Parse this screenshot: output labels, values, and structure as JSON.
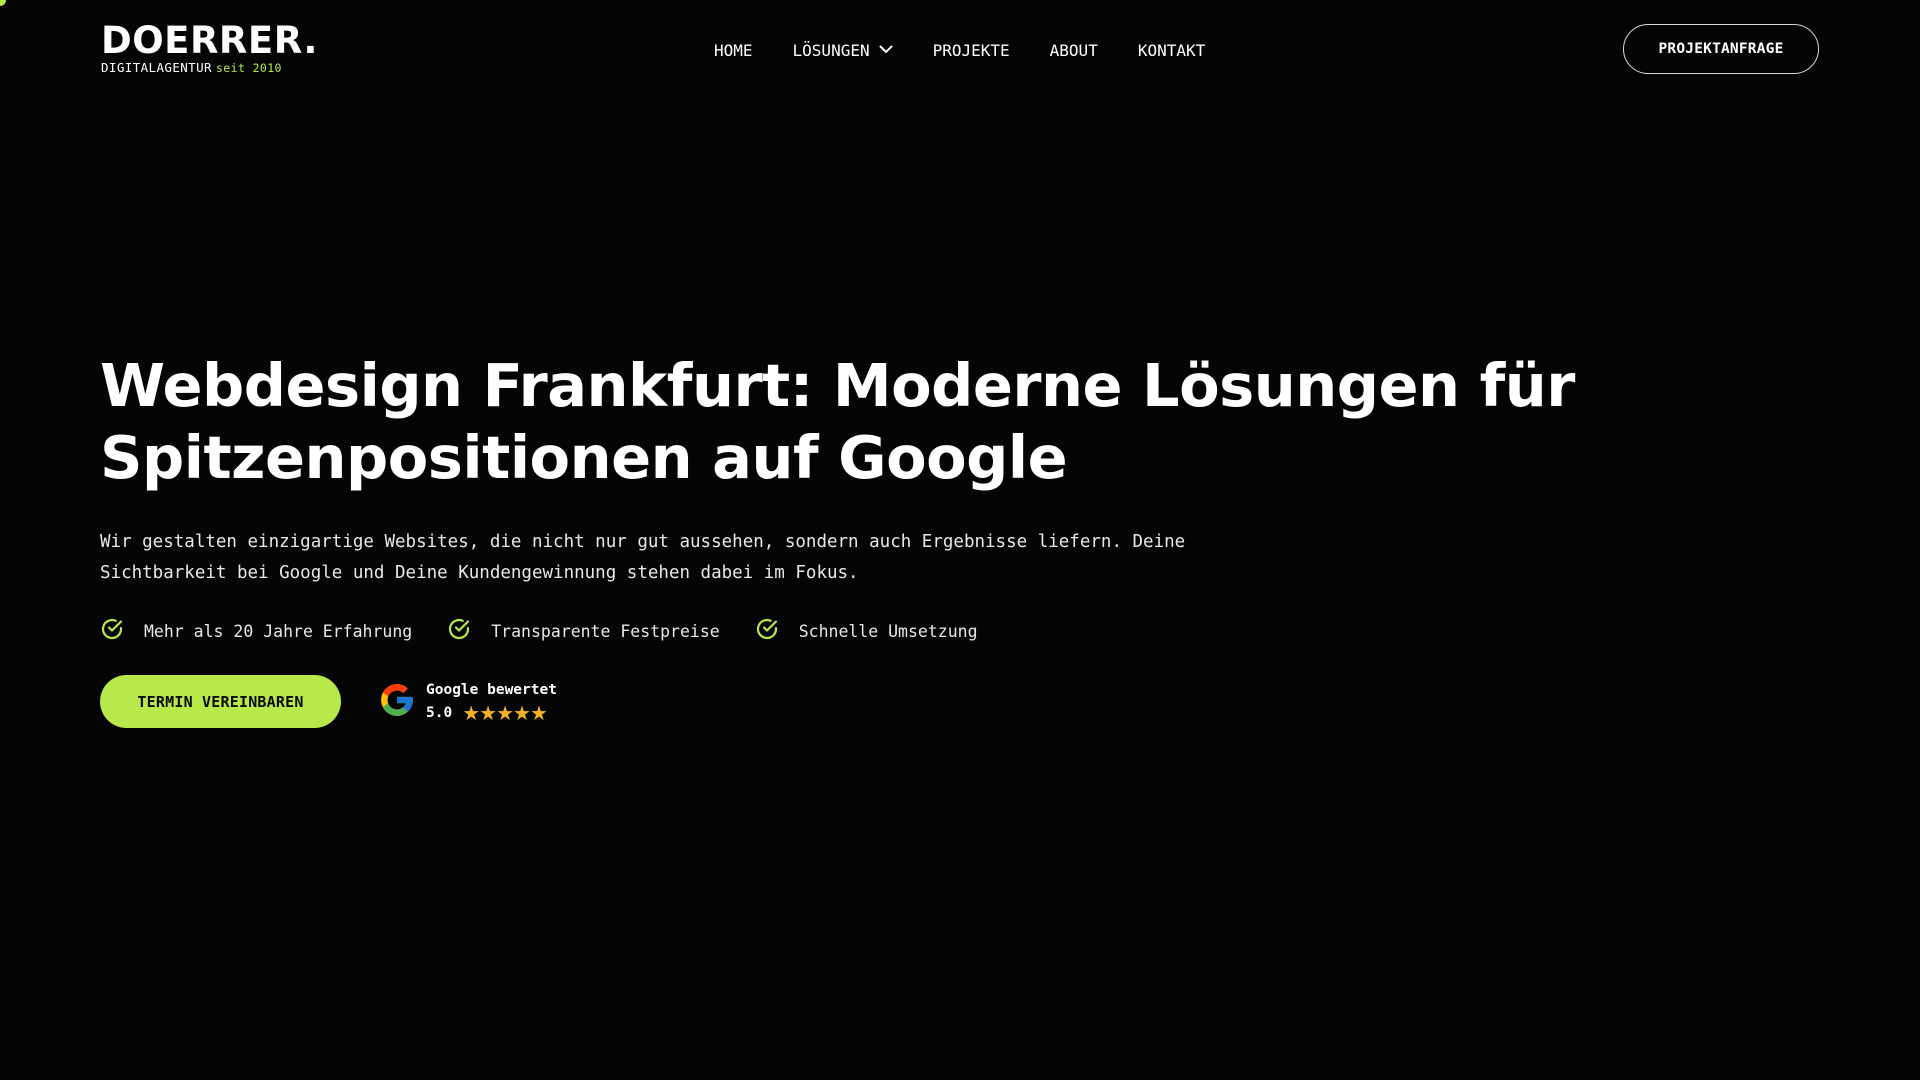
{
  "brand": {
    "name": "DOERRER.",
    "tagline": "DIGITALAGENTUR",
    "since": "seit 2010",
    "accent_color": "#b8e94a"
  },
  "nav": {
    "items": [
      {
        "label": "HOME"
      },
      {
        "label": "LÖSUNGEN",
        "icon": "chevron-down-icon"
      },
      {
        "label": "PROJEKTE"
      },
      {
        "label": "ABOUT"
      },
      {
        "label": "KONTAKT"
      }
    ],
    "cta_label": "PROJEKTANFRAGE"
  },
  "hero": {
    "title_line1": "Webdesign Frankfurt: Moderne Lösungen für",
    "title_line2": "Spitzenpositionen auf Google",
    "text_line1": "Wir gestalten einzigartige Websites, die nicht nur gut aussehen, sondern auch Ergebnisse liefern. Deine",
    "text_line2": "Sichtbarkeit bei Google und Deine Kundengewinnung stehen dabei im Fokus.",
    "features": [
      {
        "label": "Mehr als 20 Jahre Erfahrung",
        "icon": "check-circle-icon"
      },
      {
        "label": "Transparente Festpreise",
        "icon": "check-circle-icon"
      },
      {
        "label": "Schnelle Umsetzung",
        "icon": "check-circle-icon"
      }
    ],
    "cta_label": "TERMIN VEREINBAREN"
  },
  "rating": {
    "icon": "google-icon",
    "title": "Google bewertet",
    "score": "5.0",
    "stars": 5,
    "star_color": "#f5b323"
  },
  "colors": {
    "background": "#050505",
    "accent": "#b8e94a",
    "text": "#ffffff"
  }
}
